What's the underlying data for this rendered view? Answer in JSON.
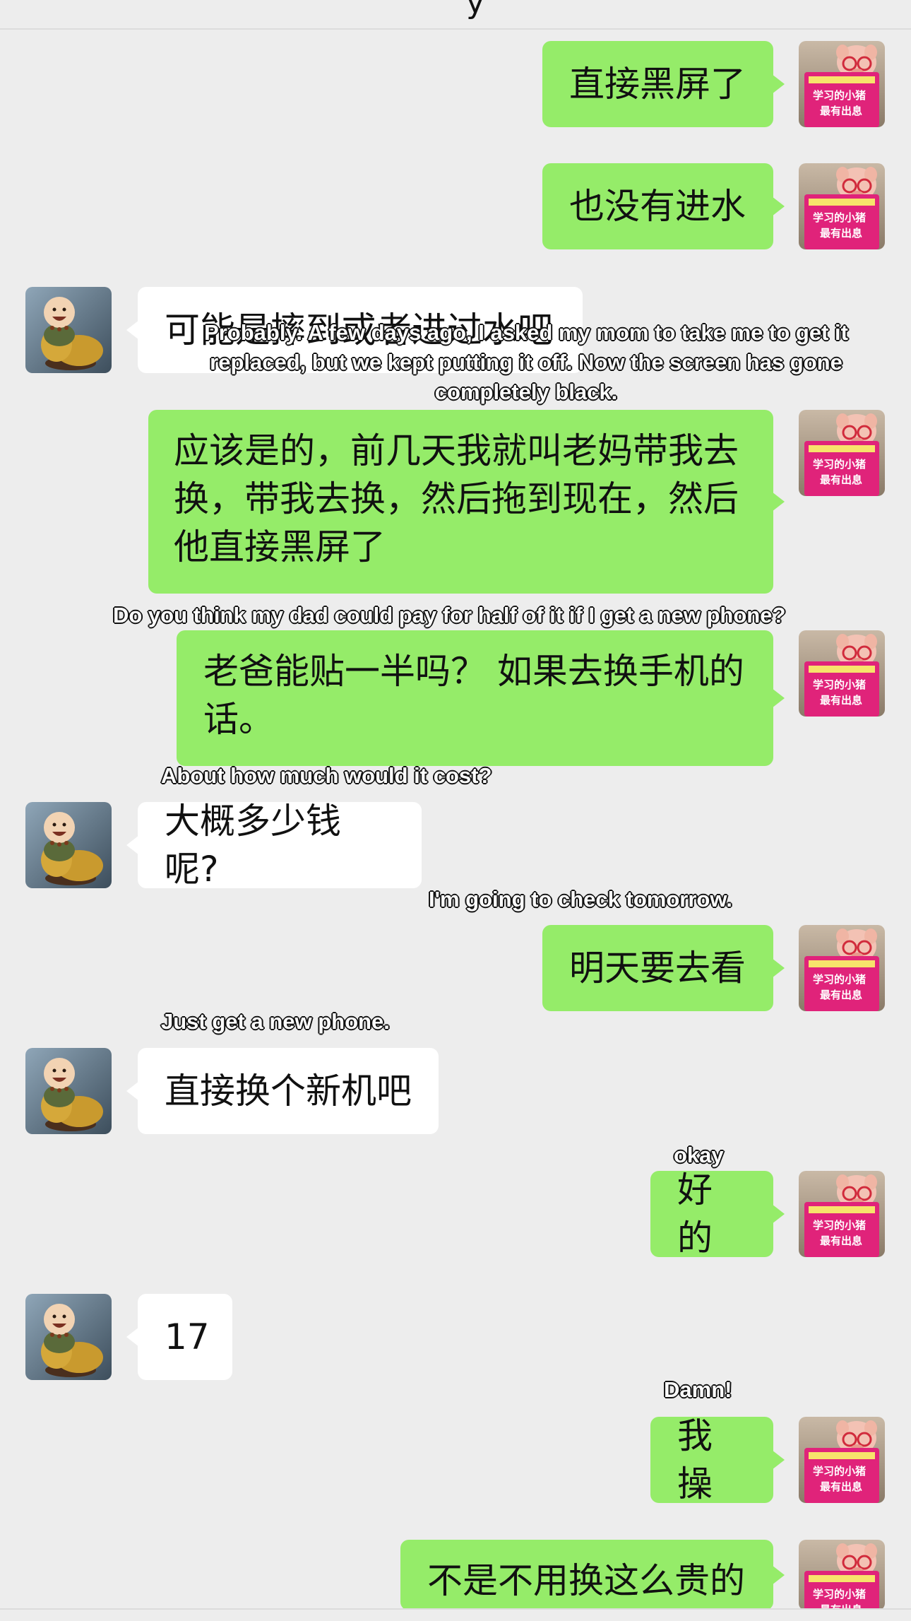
{
  "header": {
    "title_fragment": "y"
  },
  "messages": [
    {
      "sender": "me",
      "text": "直接黑屏了"
    },
    {
      "sender": "me",
      "text": "也没有进水"
    },
    {
      "sender": "them",
      "text": "可能是摔到或者进过水吧"
    },
    {
      "sender": "me",
      "text": "应该是的，前几天我就叫老妈带我去换，带我去换，然后拖到现在，然后他直接黑屏了"
    },
    {
      "sender": "me",
      "text": "老爸能贴一半吗？ 如果去换手机的话。"
    },
    {
      "sender": "them",
      "text": "大概多少钱呢?"
    },
    {
      "sender": "me",
      "text": "明天要去看"
    },
    {
      "sender": "them",
      "text": "直接换个新机吧"
    },
    {
      "sender": "me",
      "text": "好的"
    },
    {
      "sender": "them",
      "text": "17"
    },
    {
      "sender": "me",
      "text": "我操"
    },
    {
      "sender": "me",
      "text": "不是不用换这么贵的"
    }
  ],
  "captions": [
    "Probably. A few days ago, I asked my mom to take me to get it replaced, but we kept putting it off. Now the screen has gone completely black.",
    "Do you think my dad could pay for half of it if I get a new phone?",
    "About how much would it cost?",
    "I'm going to check tomorrow.",
    "Just get a new phone.",
    "okay",
    "Damn!"
  ],
  "avatars": {
    "me": {
      "icon": "pig-reading-book-avatar",
      "book_text": "爱学习的小猪最有出息"
    },
    "them": {
      "icon": "laughing-buddha-avatar"
    }
  },
  "colors": {
    "background": "#ededed",
    "my_bubble": "#95ec69",
    "their_bubble": "#ffffff"
  }
}
